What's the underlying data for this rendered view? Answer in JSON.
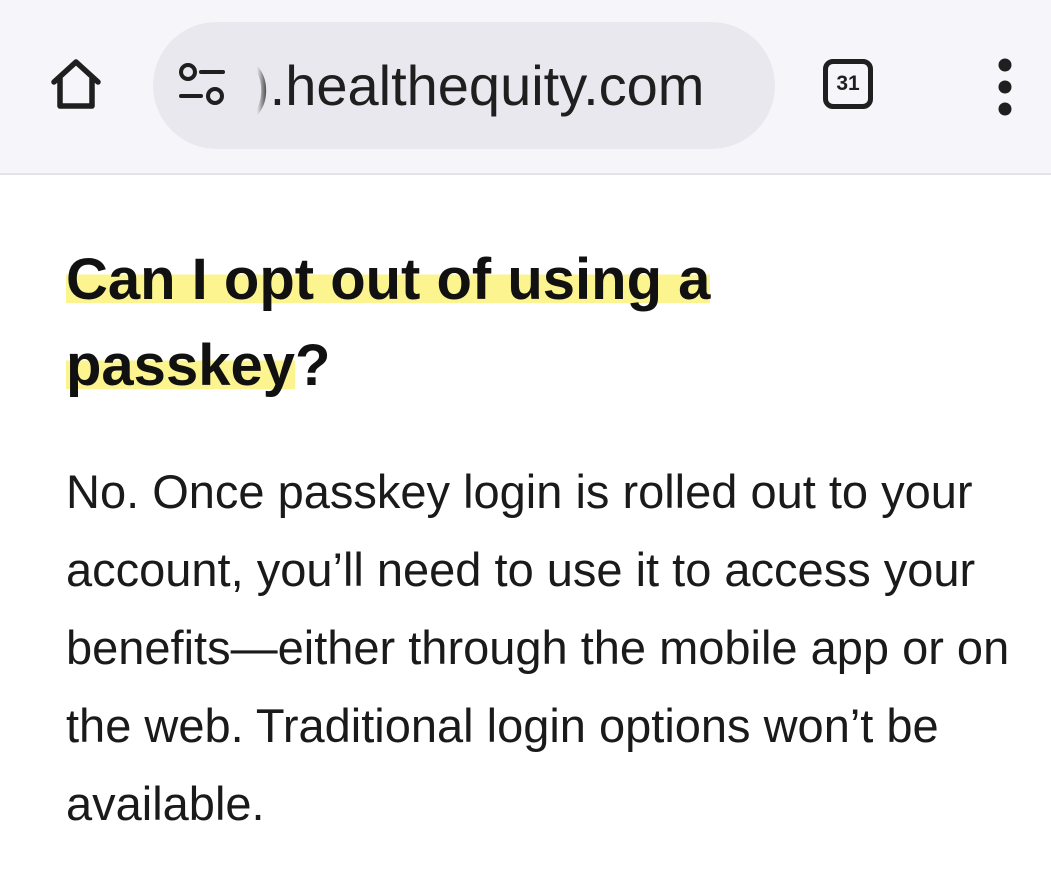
{
  "browser": {
    "url_display": ").healthequity.com",
    "tab_count": "31",
    "icons": {
      "home": "home-icon",
      "site_settings": "tune-icon",
      "menu": "more-vert-icon"
    },
    "colors": {
      "toolbar_bg": "#f6f6fa",
      "omnibox_bg": "#e8e8ee",
      "highlight": "#fbf48f"
    }
  },
  "faq": {
    "question_part1": "Can I opt out of using a passkey",
    "question_end": "?",
    "answer_first": "No",
    "answer_rest": ". Once passkey login is rolled out to your account, you’ll need to use it to access your benefits—either through the mobile app or on the web. Traditional login options won’t be available."
  }
}
